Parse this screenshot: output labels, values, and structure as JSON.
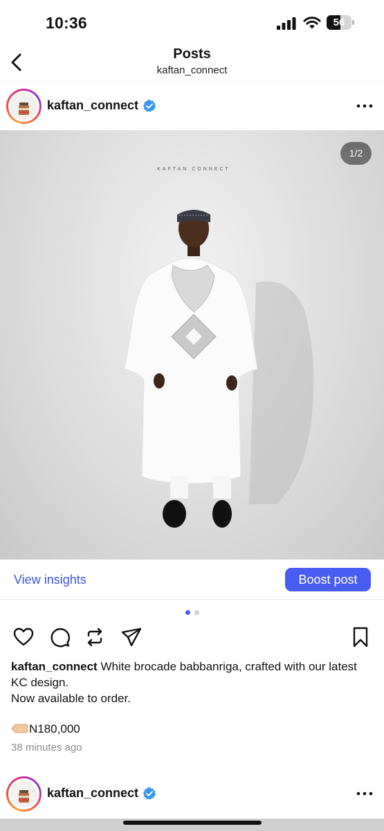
{
  "status_bar": {
    "time": "10:36",
    "battery_level": "56",
    "battery_fraction": 0.56,
    "icons": [
      "cellular-signal-icon",
      "wifi-icon",
      "battery-icon"
    ]
  },
  "nav": {
    "title": "Posts",
    "subtitle": "kaftan_connect",
    "back_icon": "chevron-left-icon"
  },
  "post": {
    "username": "kaftan_connect",
    "verified": true,
    "more_icon": "more-horizontal-icon",
    "image": {
      "counter": "1/2",
      "watermark": "KAFTAN CONNECT",
      "current_slide": 1,
      "total_slides": 2
    },
    "view_insights_label": "View insights",
    "boost_label": "Boost post",
    "action_icons": [
      "heart-icon",
      "comment-icon",
      "repost-icon",
      "share-icon",
      "bookmark-icon"
    ],
    "caption_username": "kaftan_connect",
    "caption_text": "White brocade babbanriga, crafted with our latest KC design.",
    "caption_line2": "Now available to order.",
    "price": "N180,000",
    "posted_ago": "38 minutes ago"
  },
  "next_post": {
    "username": "kaftan_connect",
    "verified": true
  },
  "colors": {
    "accent_blue": "#4a5df2",
    "link_blue": "#3a56e0",
    "verified_blue": "#3897f0",
    "muted_text": "#8a8a8a",
    "dot_inactive": "#d0d0d0"
  }
}
